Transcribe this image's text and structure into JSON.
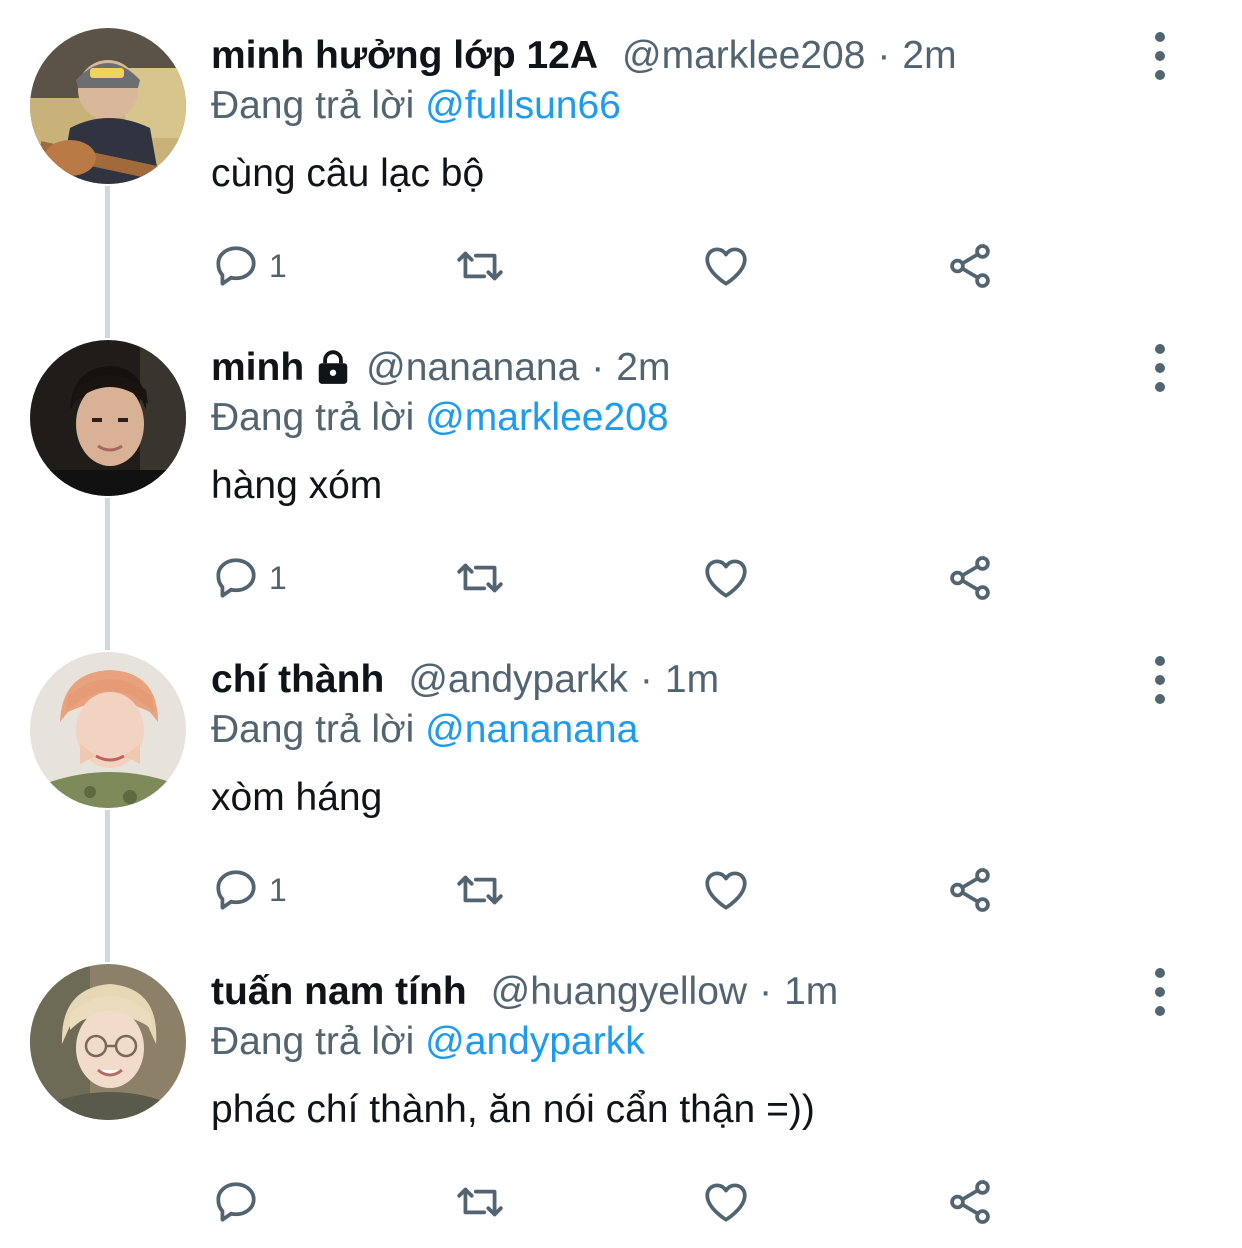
{
  "tweets": [
    {
      "name": "minh hưởng lớp 12A",
      "handle": "@marklee208",
      "separator": "·",
      "time": "2m",
      "replying_prefix": "Đang trả lời ",
      "replying_to": "@fullsun66",
      "text": "cùng câu lạc bộ",
      "reply_count": "1",
      "locked": false
    },
    {
      "name": "minh",
      "handle": "@nananana",
      "separator": "·",
      "time": "2m",
      "replying_prefix": "Đang trả lời ",
      "replying_to": "@marklee208",
      "text": "hàng xóm",
      "reply_count": "1",
      "locked": true
    },
    {
      "name": "chí thành",
      "handle": "@andyparkk",
      "separator": "·",
      "time": "1m",
      "replying_prefix": "Đang trả lời ",
      "replying_to": "@nananana",
      "text": "xòm háng",
      "reply_count": "1",
      "locked": false
    },
    {
      "name": "tuấn nam tính",
      "handle": "@huangyellow",
      "separator": "·",
      "time": "1m",
      "replying_prefix": "Đang trả lời ",
      "replying_to": "@andyparkk",
      "text": "phác chí thành, ăn nói cẩn thận =))",
      "reply_count": "",
      "locked": false
    }
  ],
  "icons": {
    "reply": "reply-icon",
    "retweet": "retweet-icon",
    "like": "heart-icon",
    "share": "share-icon",
    "more": "more-options-icon",
    "lock": "lock-icon"
  },
  "colors": {
    "mention": "#1d9bf0",
    "secondary_text": "#536471",
    "primary_text": "#0f1419",
    "thread_line": "#cfd9de"
  }
}
